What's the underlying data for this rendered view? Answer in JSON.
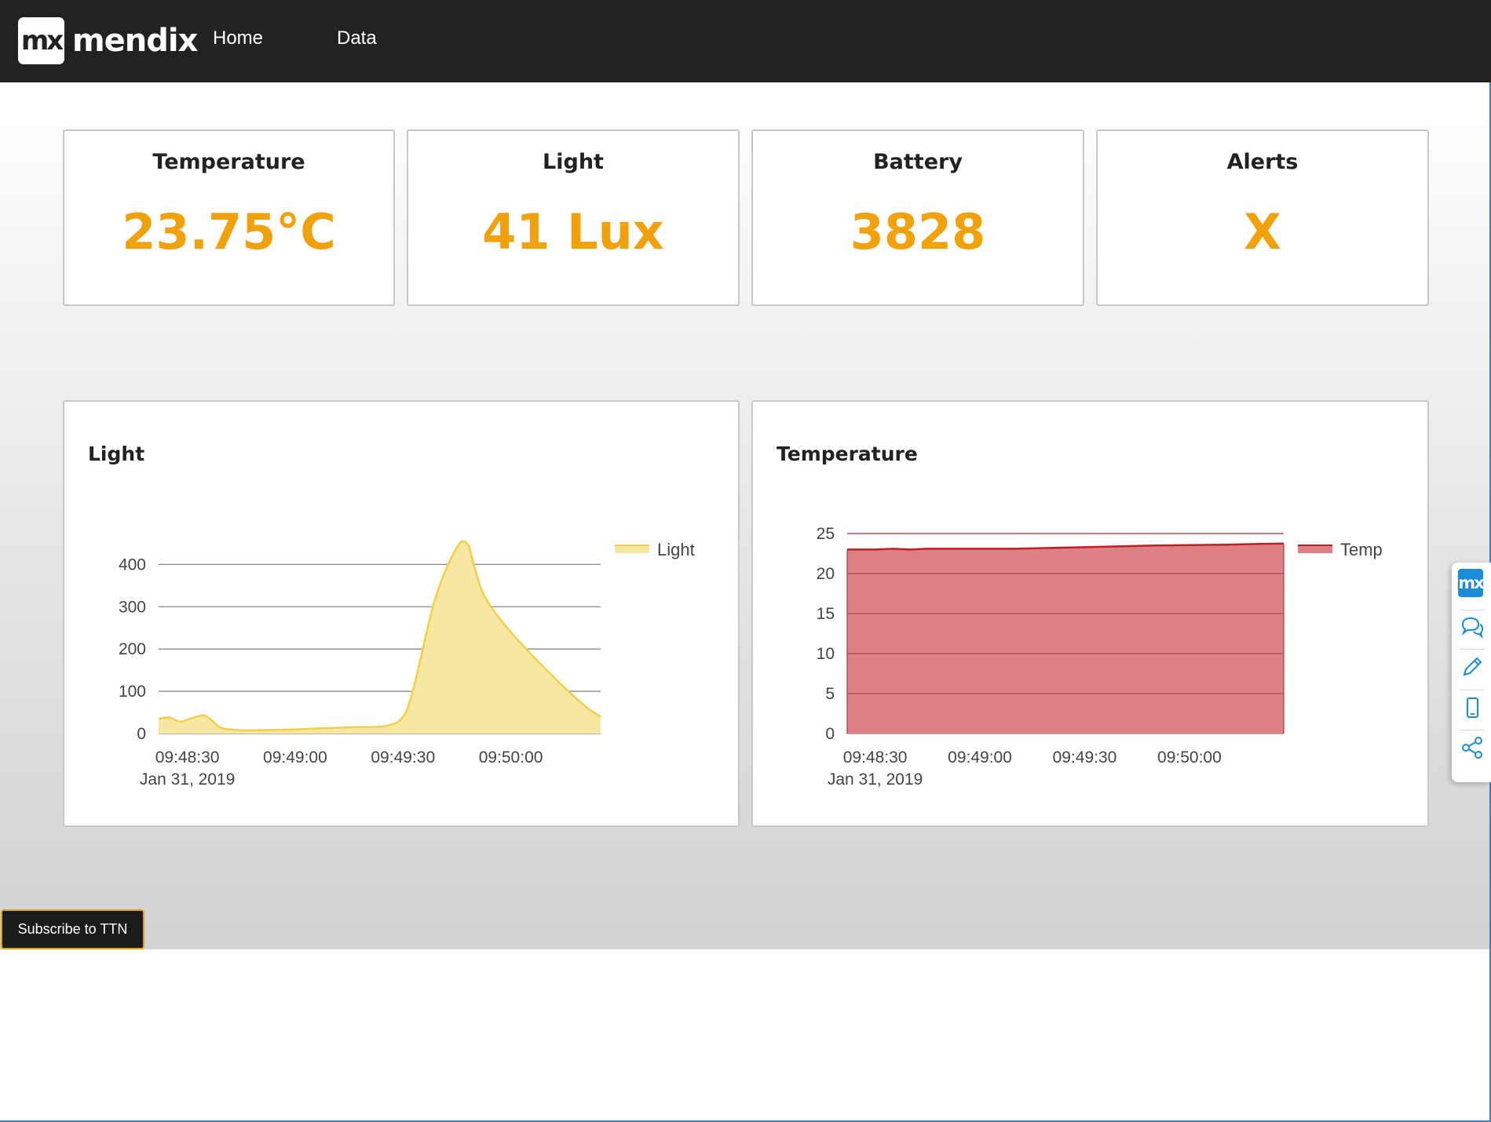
{
  "header": {
    "logo_mark": "mx",
    "logo_text": "mendix",
    "nav": [
      {
        "label": "Home"
      },
      {
        "label": "Data"
      }
    ]
  },
  "stats": [
    {
      "title": "Temperature",
      "value": "23.75°C"
    },
    {
      "title": "Light",
      "value": "41 Lux"
    },
    {
      "title": "Battery",
      "value": "3828"
    },
    {
      "title": "Alerts",
      "value": "X"
    }
  ],
  "colors": {
    "stat_value": "#f1a10b",
    "light_fill": "#f8e7a3",
    "light_line": "#f2cf4a",
    "temp_fill": "#dd8185",
    "temp_line": "#c01f25",
    "topbar": "#222222"
  },
  "chart_data": [
    {
      "type": "area",
      "title": "Light",
      "x": [
        "09:48:22",
        "09:48:25",
        "09:48:28",
        "09:48:31",
        "09:48:35",
        "09:48:39",
        "09:48:42",
        "09:48:45",
        "09:48:50",
        "09:49:00",
        "09:49:15",
        "09:49:25",
        "09:49:30",
        "09:49:33",
        "09:49:39",
        "09:49:45",
        "09:49:48",
        "09:49:50",
        "09:49:53",
        "09:50:00",
        "09:50:10",
        "09:50:20",
        "09:50:25"
      ],
      "x_tick_labels": [
        "09:48:30",
        "09:49:00",
        "09:49:30",
        "09:50:00"
      ],
      "x_date_label": "Jan 31, 2019",
      "series": [
        {
          "name": "Light",
          "values": [
            35,
            38,
            28,
            36,
            42,
            15,
            10,
            8,
            8,
            10,
            15,
            18,
            40,
            110,
            320,
            440,
            448,
            390,
            320,
            240,
            150,
            70,
            40
          ]
        }
      ],
      "y_ticks": [
        0,
        100,
        200,
        300,
        400
      ],
      "ylim": [
        0,
        460
      ],
      "grid": true,
      "legend": "top-right"
    },
    {
      "type": "area",
      "title": "Temperature",
      "x": [
        "09:48:22",
        "09:48:30",
        "09:48:35",
        "09:48:40",
        "09:48:45",
        "09:48:50",
        "09:49:00",
        "09:49:10",
        "09:49:20",
        "09:49:30",
        "09:49:40",
        "09:49:50",
        "09:50:00",
        "09:50:10",
        "09:50:20",
        "09:50:27"
      ],
      "x_tick_labels": [
        "09:48:30",
        "09:49:00",
        "09:49:30",
        "09:50:00"
      ],
      "x_date_label": "Jan 31, 2019",
      "series": [
        {
          "name": "Temp",
          "values": [
            23.0,
            23.0,
            23.1,
            23.0,
            23.1,
            23.1,
            23.1,
            23.1,
            23.2,
            23.3,
            23.4,
            23.5,
            23.55,
            23.6,
            23.7,
            23.75
          ]
        }
      ],
      "y_ticks": [
        0,
        5,
        10,
        15,
        20,
        25
      ],
      "ylim": [
        0,
        25
      ],
      "grid": true,
      "legend": "top-right"
    }
  ],
  "footer": {
    "subscribe_label": "Subscribe to TTN"
  },
  "side_toolbar": {
    "badge": "mx",
    "icons": [
      "chat-icon",
      "pencil-icon",
      "mobile-icon",
      "share-icon"
    ]
  }
}
